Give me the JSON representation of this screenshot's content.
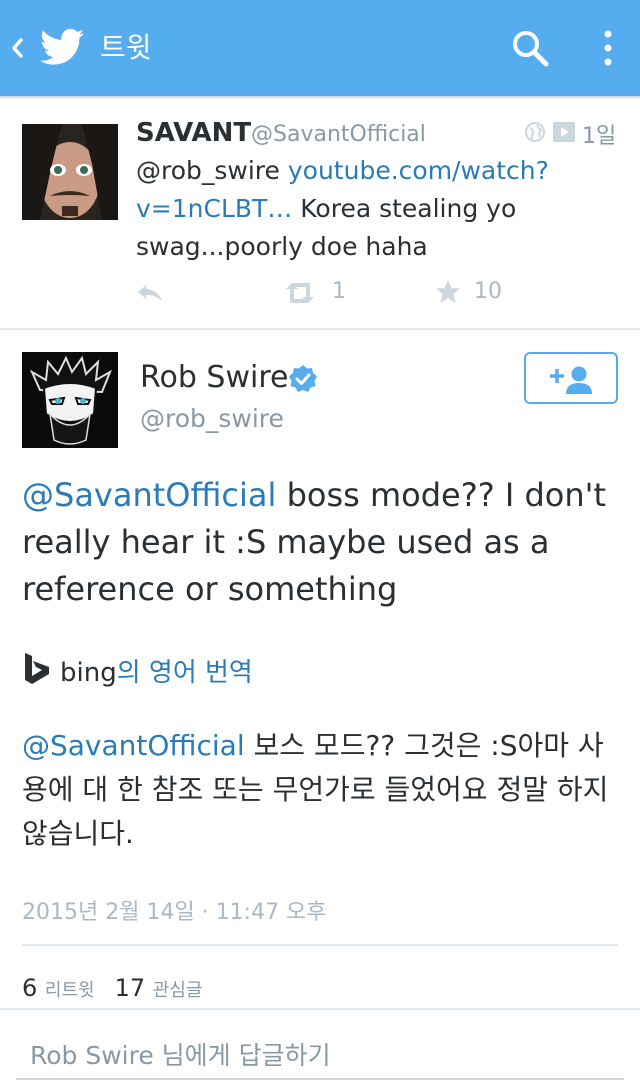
{
  "header": {
    "title": "트윗",
    "accent_color": "#55acee",
    "icons": [
      "chevron-left-icon",
      "twitter-bird-icon",
      "search-icon",
      "more-vert-icon"
    ]
  },
  "parent_tweet": {
    "display_name": "SAVANT",
    "handle": "@SavantOfficial",
    "time": "1일",
    "text_mention": "@rob_swire",
    "text_link": "youtube.com/watch?v=1nCLBT…",
    "text_rest": "Korea stealing yo swag...poorly doe haha",
    "retweet_count": "1",
    "favorite_count": "10"
  },
  "main_tweet": {
    "display_name": "Rob Swire",
    "handle": "@rob_swire",
    "mention": "@SavantOfficial",
    "text": "boss mode?? I don't really hear it :S maybe used as a reference or something",
    "translate_brand": "bing",
    "translate_label": "의 영어 번역",
    "translation_mention": "@SavantOfficial",
    "translation_text": "보스 모드?? 그것은 :S아마 사용에 대 한 참조 또는 무언가로 들었어요 정말 하지 않습니다.",
    "timestamp": "2015년 2월 14일 · 11:47 오후",
    "retweets_count": "6",
    "retweets_label": "리트윗",
    "favorites_count": "17",
    "favorites_label": "관심글"
  },
  "reply": {
    "placeholder": "Rob Swire 님에게 답글하기"
  }
}
